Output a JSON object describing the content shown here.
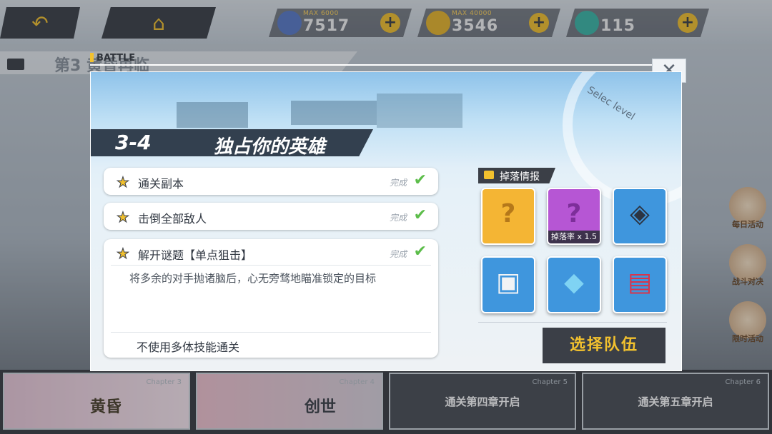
{
  "top_bar": {
    "back_icon": "back-arrow-icon",
    "home_icon": "home-icon",
    "resources": [
      {
        "icon": "energy-icon",
        "max": "MAX 6000",
        "value": "7517",
        "color": "#5a7ac7"
      },
      {
        "icon": "gold-coin-icon",
        "max": "MAX 40000",
        "value": "3546",
        "color": "#e7b52b"
      },
      {
        "icon": "crystal-icon",
        "max": "",
        "value": "115",
        "color": "#3cb7a7"
      }
    ]
  },
  "background": {
    "chapter_title": "第3",
    "chapter_title_tail": "黄昏再临",
    "side_menu": [
      "每日活动",
      "战斗对决",
      "限时活动"
    ],
    "bottom_cards": [
      {
        "caption": "Chapter 3",
        "name": "黄昏"
      },
      {
        "caption": "Chapter 4",
        "name": "创世"
      },
      {
        "caption": "Chapter 5",
        "name": "通关第四章开启"
      },
      {
        "caption": "Chapter 6",
        "name": "通关第五章开启"
      }
    ]
  },
  "modal": {
    "battle_label": "BATTLE",
    "close_label": "✕",
    "select_level_text": "Selec level",
    "stage_number": "3-4",
    "stage_name": "独占你的英雄",
    "tasks": [
      {
        "label": "通关副本",
        "status": "完成"
      },
      {
        "label": "击倒全部敌人",
        "status": "完成"
      }
    ],
    "puzzle": {
      "label": "解开谜题【单点狙击】",
      "status": "完成",
      "description": "将多余的对手抛诸脑后，心无旁骛地瞄准锁定的目标",
      "extra": "不使用多体技能通关"
    },
    "drops": {
      "header": "掉落情报",
      "items": [
        {
          "name": "unknown-hero",
          "symbol": "?",
          "bg": "#f4b534"
        },
        {
          "name": "unknown-equip",
          "symbol": "?",
          "bg": "#b656d4",
          "rate_label": "掉落率",
          "rate_value": "x 1.5"
        },
        {
          "name": "helmet-chip",
          "symbol": "◈",
          "bg": "#3f96dd"
        },
        {
          "name": "armor-box",
          "symbol": "▣",
          "bg": "#3f96dd"
        },
        {
          "name": "data-card",
          "symbol": "◆",
          "bg": "#3f96dd"
        },
        {
          "name": "red-chip",
          "symbol": "▤",
          "bg": "#3f96dd"
        }
      ]
    },
    "select_team_label": "选择队伍"
  }
}
